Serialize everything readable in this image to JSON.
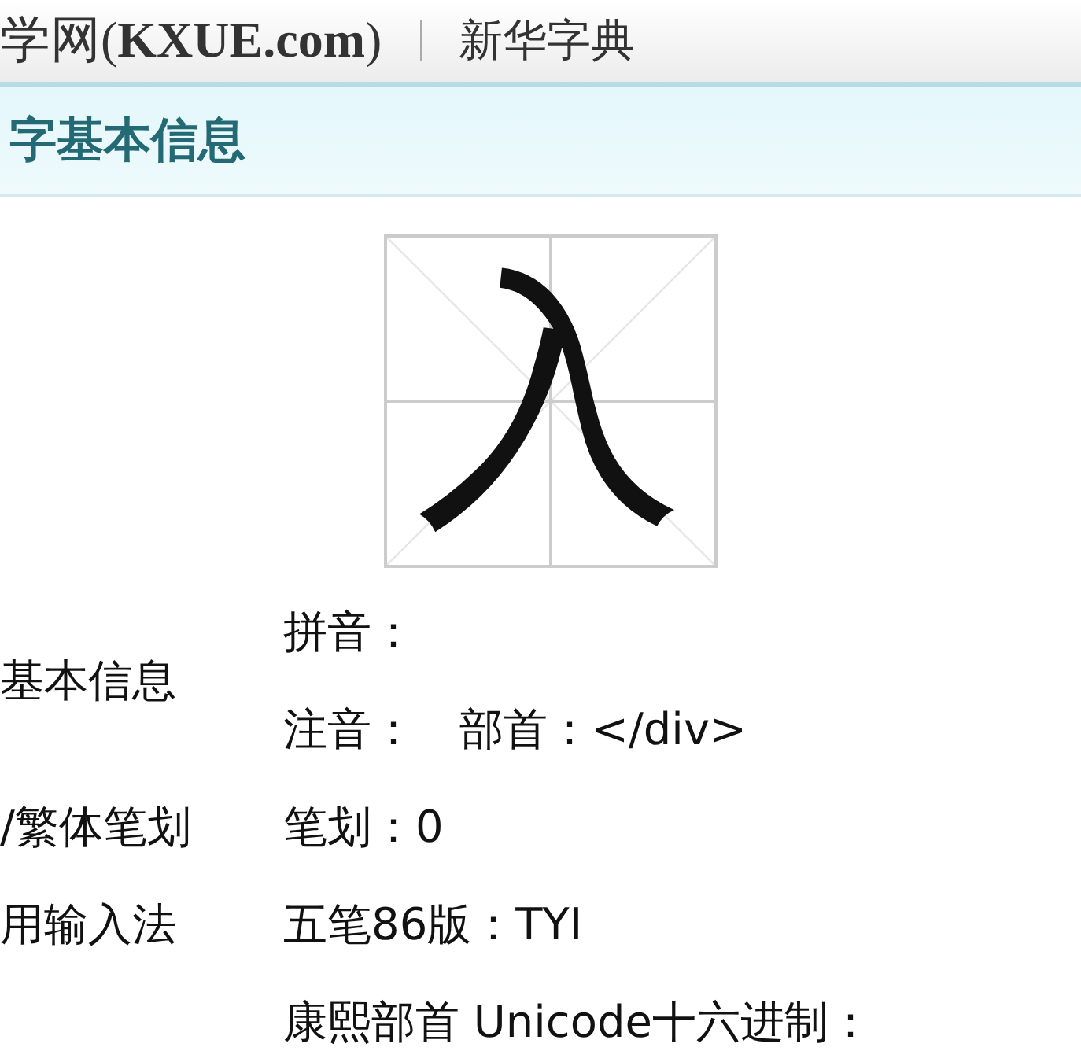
{
  "header": {
    "site": "学网(**KXUE.com**)",
    "section": "新华字典"
  },
  "panel": {
    "title": "字基本信息",
    "character": "入"
  },
  "info_rows": [
    {
      "label": "基本信息",
      "values": [
        "拼音：",
        "注音：　部首：</div>"
      ]
    },
    {
      "label": "/繁体笔划",
      "values": [
        "笔划：0"
      ]
    },
    {
      "label": "用输入法",
      "values": [
        "五笔86版：TYI"
      ]
    },
    {
      "label": "",
      "values": [
        "康熙部首 Unicode十六进制："
      ]
    }
  ]
}
